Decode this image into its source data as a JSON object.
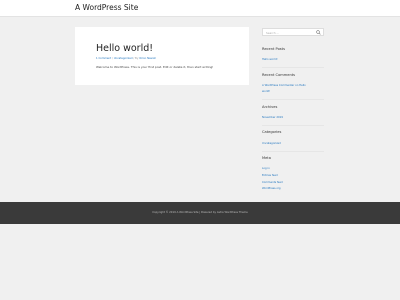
{
  "header": {
    "site_title": "A WordPress Site"
  },
  "post": {
    "title": "Hello world!",
    "meta": {
      "comments": "1 Comment",
      "sep1": " / ",
      "category": "Uncategorized",
      "sep2": " / By ",
      "author": "Orion Nasrat"
    },
    "body": "Welcome to WordPress. This is your first post. Edit or delete it, then start writing!"
  },
  "sidebar": {
    "search": {
      "placeholder": "Search ..."
    },
    "recent_posts": {
      "title": "Recent Posts",
      "items": [
        "Hello world!"
      ]
    },
    "recent_comments": {
      "title": "Recent Comments",
      "line1": "A WordPress Commenter on Hello",
      "line2": "world!"
    },
    "archives": {
      "title": "Archives",
      "items": [
        "November 2019"
      ]
    },
    "categories": {
      "title": "Categories",
      "items": [
        "Uncategorized"
      ]
    },
    "meta": {
      "title": "Meta",
      "items": [
        "Log in",
        "Entries feed",
        "Comments feed",
        "WordPress.org"
      ]
    }
  },
  "footer": {
    "text": "Copyright © 2019 A WordPress Site | Powered by Astra WordPress Theme"
  },
  "colors": {
    "link": "#1e73be",
    "background": "#f0f0f0",
    "footer": "#3a3a3a"
  }
}
